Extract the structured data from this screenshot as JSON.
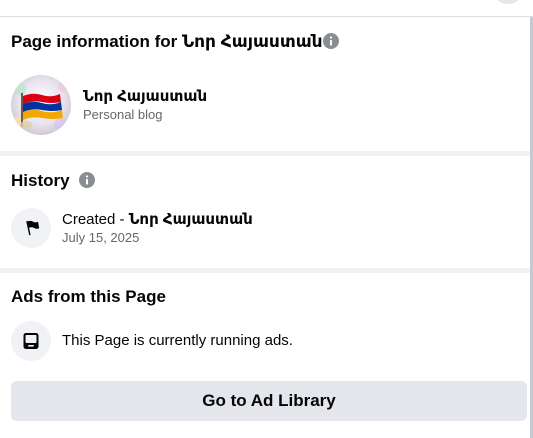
{
  "page_info": {
    "title_prefix": "Page information for",
    "page_name": "Նոր Հայաստան",
    "category": "Personal blog"
  },
  "history": {
    "title": "History",
    "created_label": "Created - ",
    "created_name": "Նոր Հայաստան",
    "created_date": "July 15, 2025"
  },
  "ads": {
    "title": "Ads from this Page",
    "status": "This Page is currently running ads.",
    "button_label": "Go to Ad Library"
  },
  "icons": {
    "info": "info-icon",
    "flag": "flag-icon",
    "ads": "ad-library-icon"
  },
  "colors": {
    "section_gap": "#f0f2f5",
    "secondary_text": "#65676b",
    "button_bg": "#e4e6eb",
    "icon_gray": "#8a8d91",
    "flag_red": "#d90012",
    "flag_blue": "#0033a0",
    "flag_orange": "#f2a800"
  }
}
